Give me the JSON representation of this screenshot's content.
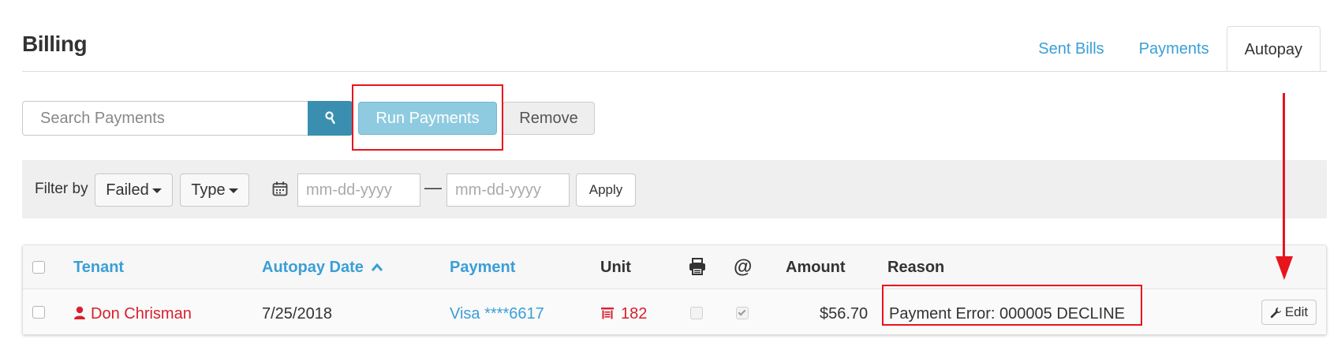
{
  "page": {
    "title": "Billing"
  },
  "tabs": [
    {
      "label": "Sent Bills",
      "active": false
    },
    {
      "label": "Payments",
      "active": false
    },
    {
      "label": "Autopay",
      "active": true
    }
  ],
  "toolbar": {
    "search_placeholder": "Search Payments",
    "search_icon": "search-icon",
    "run_payments_label": "Run Payments",
    "remove_label": "Remove"
  },
  "filter": {
    "label": "Filter by",
    "status_value": "Failed",
    "type_value": "Type",
    "calendar_icon": "calendar-icon",
    "date_from_placeholder": "mm-dd-yyyy",
    "date_separator": "—",
    "date_to_placeholder": "mm-dd-yyyy",
    "apply_label": "Apply"
  },
  "table": {
    "columns": {
      "tenant": "Tenant",
      "autopay_date": "Autopay Date",
      "payment": "Payment",
      "unit": "Unit",
      "print_icon": "printer-icon",
      "email_icon": "@",
      "amount": "Amount",
      "reason": "Reason"
    },
    "sort": {
      "column": "autopay_date",
      "direction": "ascending"
    },
    "rows": [
      {
        "tenant": "Don Chrisman",
        "autopay_date": "7/25/2018",
        "payment": "Visa ****6617",
        "unit": "182",
        "print_checked": false,
        "email_checked": true,
        "amount": "$56.70",
        "reason": "Payment Error: 000005 DECLINE",
        "edit_label": "Edit"
      }
    ]
  },
  "colors": {
    "link": "#3a9fd6",
    "tenant_red": "#d8202c",
    "annotation_red": "#e8141e",
    "search_button": "#3a8fb0",
    "run_button": "#8fcbe0"
  }
}
